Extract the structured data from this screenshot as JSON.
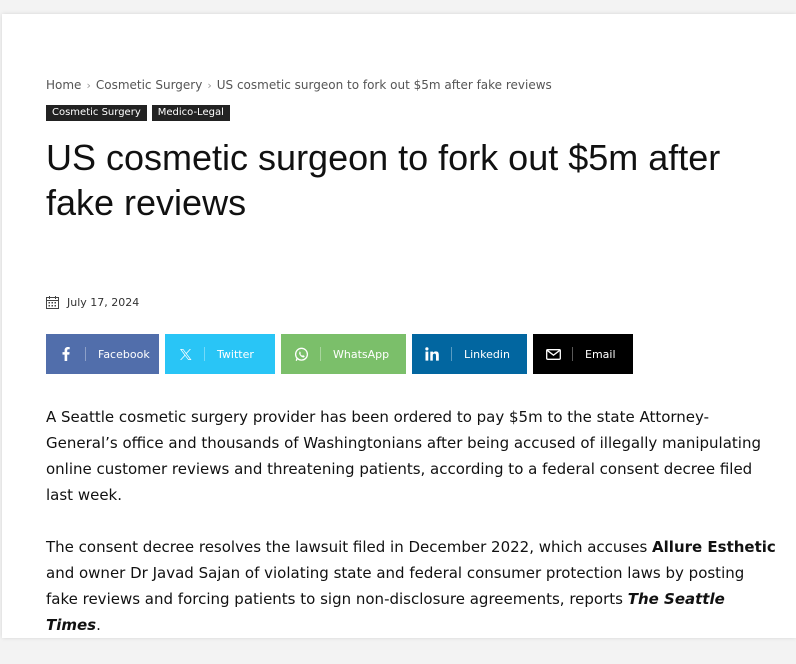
{
  "breadcrumb": {
    "home": "Home",
    "category": "Cosmetic Surgery",
    "current": "US cosmetic surgeon to fork out $5m after fake reviews",
    "separator": "›"
  },
  "categories": [
    "Cosmetic Surgery",
    "Medico-Legal"
  ],
  "article": {
    "title": "US cosmetic surgeon to fork out $5m after fake reviews",
    "date": "July 17, 2024",
    "p1": "A Seattle cosmetic surgery provider has been ordered to pay $5m to the state Attorney-General’s office and thousands of Washingtonians after being accused of illegally manipulating online customer reviews and threatening patients, according to a federal consent decree filed last week.",
    "p2_a": "The consent decree resolves the lawsuit filed in December 2022, which accuses ",
    "p2_bold": "Allure Esthetic",
    "p2_b": " and owner Dr Javad Sajan of violating state and federal consumer protection laws by posting fake reviews and forcing patients to sign non-disclosure agreements, reports ",
    "p2_italic": "The Seattle Times",
    "p2_c": "."
  },
  "share": {
    "facebook": "Facebook",
    "twitter": "Twitter",
    "whatsapp": "WhatsApp",
    "linkedin": "Linkedin",
    "email": "Email"
  },
  "colors": {
    "facebook": "#516eab",
    "twitter": "#29c5f6",
    "whatsapp": "#7bbf6a",
    "linkedin": "#0266a0",
    "email": "#000000",
    "category_badge": "#222222"
  },
  "icons": [
    "calendar-icon",
    "facebook-icon",
    "x-twitter-icon",
    "whatsapp-icon",
    "linkedin-icon",
    "email-icon"
  ]
}
